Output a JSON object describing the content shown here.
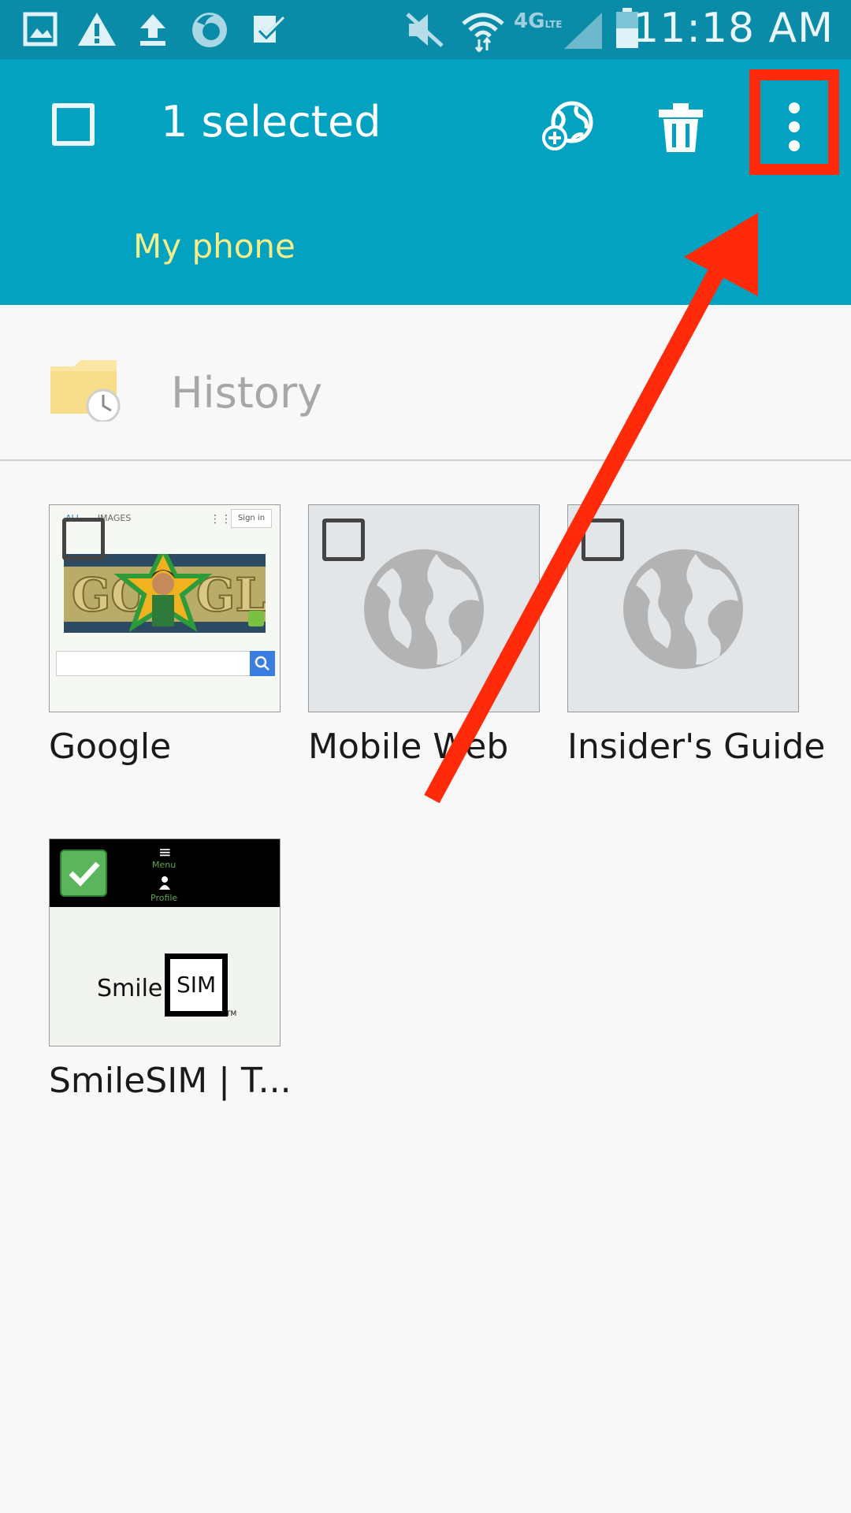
{
  "status_bar": {
    "time": "11:18 AM",
    "icons": [
      "gallery-icon",
      "warning-icon",
      "upload-icon",
      "firefox-icon",
      "tasks-icon",
      "mute-icon",
      "wifi-icon",
      "4g-lte-icon",
      "signal-icon",
      "battery-icon"
    ]
  },
  "action_bar": {
    "selected_text": "1 selected",
    "location_tab": "My phone",
    "colors": {
      "bar": "#04a2c1",
      "status": "#0a8ba8",
      "tab_text": "#f3ee8a"
    }
  },
  "history": {
    "label": "History"
  },
  "tiles": [
    {
      "title": "Google",
      "checked": false,
      "thumb": {
        "nav_all": "ALL",
        "nav_images": "IMAGES",
        "sign_in": "Sign in"
      }
    },
    {
      "title": "Mobile Web",
      "checked": false
    },
    {
      "title": "Insider's Guide",
      "checked": false
    },
    {
      "title": "SmileSIM | T...",
      "checked": true,
      "thumb": {
        "menu": "Menu",
        "profile": "Profile",
        "logo_word": "Smile",
        "logo_box": "SIM",
        "tm": "TM"
      }
    }
  ],
  "annotation": {
    "color": "#ff2a0a",
    "target": "more-options-button"
  }
}
